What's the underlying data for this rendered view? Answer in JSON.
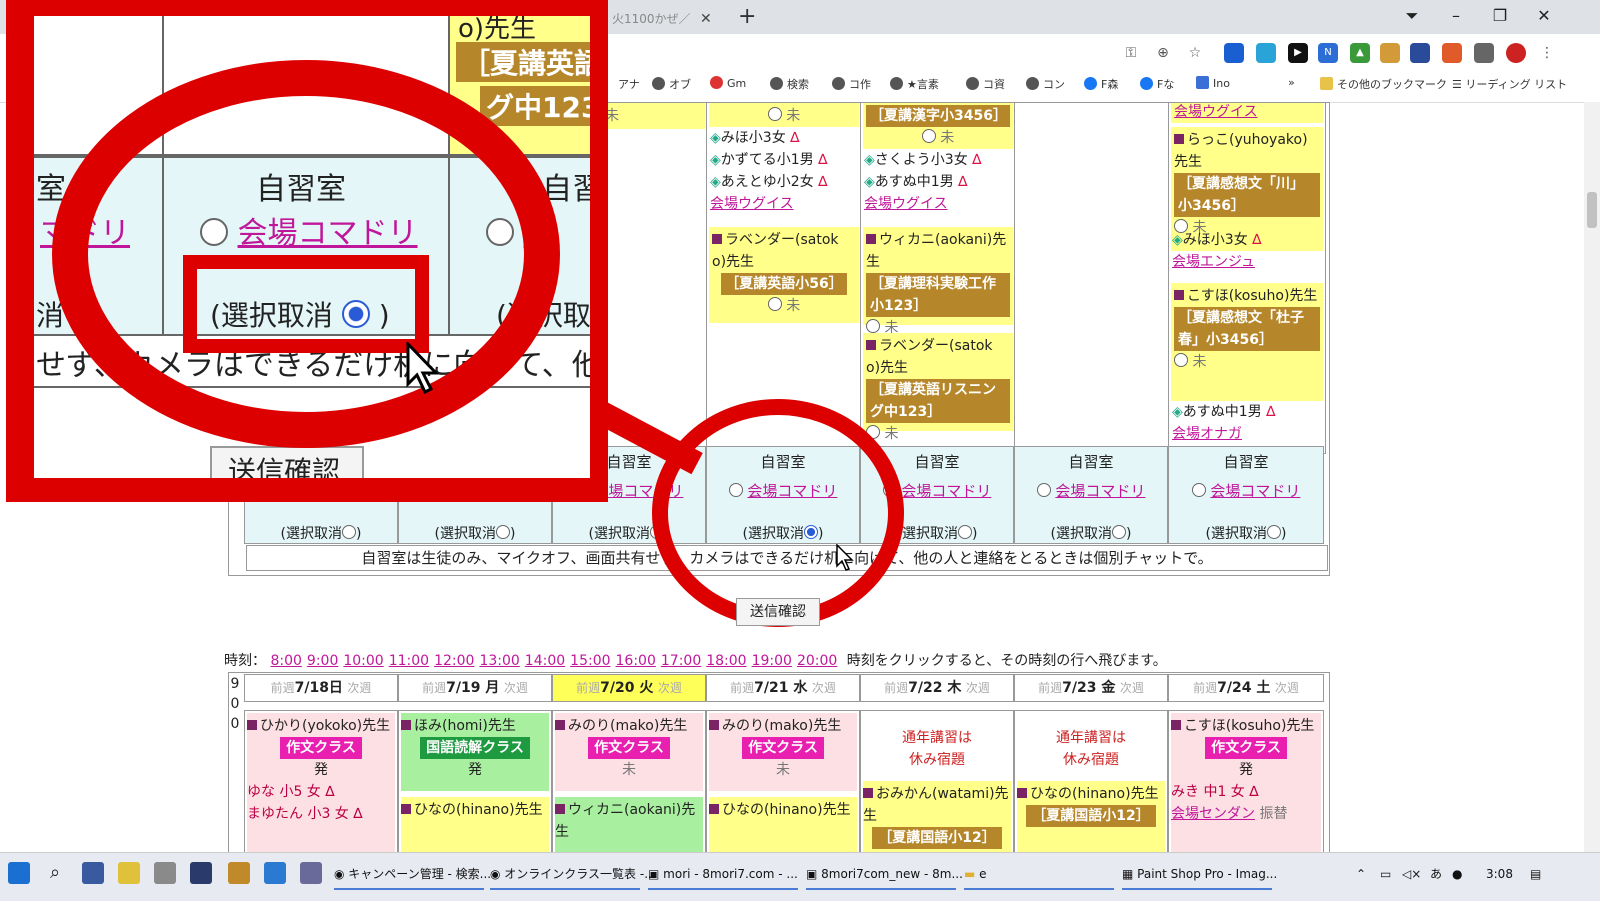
{
  "browser": {
    "tab_title": "火1100かぜ／",
    "bookmarks": [
      "アナ",
      "オブ",
      "Gm",
      "検索",
      "コ作",
      "★言素",
      "コ資",
      "コン",
      "F森",
      "Fな",
      "Ino",
      "その他のブックマーク",
      "リーディング リスト"
    ],
    "more_label": "»"
  },
  "columns": {
    "tue": {
      "badge_top": "6]",
      "mi": "未"
    },
    "wed": {
      "mi_top": "未",
      "students": [
        {
          "name": "みほ小3女",
          "mark": "∆"
        },
        {
          "name": "かずてる小1男",
          "mark": "∆"
        },
        {
          "name": "あえとゆ小2女",
          "mark": "∆"
        }
      ],
      "venue": "会場ウグイス",
      "card": {
        "teacher": "ラベンダー(satok o)先生",
        "badge": "［夏講英語小56］",
        "mi": "未"
      }
    },
    "thu": {
      "badge_top": "［夏講漢字小3456］",
      "mi_top": "未",
      "students": [
        {
          "name": "さくよう小3女",
          "mark": "∆"
        },
        {
          "name": "あすぬ中1男",
          "mark": "∆"
        }
      ],
      "venue": "会場ウグイス",
      "card1": {
        "teacher": "ウィカニ(aokani)先生",
        "badge": "［夏講理科実験工作小123］",
        "mi": "未"
      },
      "card2": {
        "teacher": "ラベンダー(satok o)先生",
        "badge": "［夏講英語リスニング中123］",
        "mi": "未"
      }
    },
    "sat": {
      "venue_top": "会場ウグイス",
      "card1": {
        "teacher": "らっこ(yuhoyako)先生",
        "badge": "［夏講感想文「川」小3456］",
        "mi": "未"
      },
      "student1": {
        "name": "みほ小3女",
        "mark": "∆"
      },
      "venue1": "会場エンジュ",
      "card2": {
        "teacher": "こすほ(kosuho)先生",
        "badge": "［夏講感想文「杜子春」小3456］",
        "mi": "未"
      },
      "student2": {
        "name": "あすぬ中1男",
        "mark": "∆"
      },
      "venue2": "会場オナガ"
    }
  },
  "selfstudy": {
    "heading": "自習室",
    "venue": "会場コマドリ",
    "cancel_prefix": "(選択取消",
    "cancel_suffix": ")"
  },
  "notice": "自習室は生徒のみ、マイクオフ、画面共有せず、カメラはできるだけ机に向けて、他の人と連絡をとるときは個別チャットで。",
  "send_button": "送信確認",
  "timebar": {
    "label": "時刻：",
    "times": [
      "8:00",
      "9:00",
      "10:00",
      "11:00",
      "12:00",
      "13:00",
      "14:00",
      "15:00",
      "16:00",
      "17:00",
      "18:00",
      "19:00",
      "20:00"
    ],
    "hint": "時刻をクリックすると、その時刻の行へ飛びます。"
  },
  "week": {
    "hour": [
      "9",
      "0",
      "0"
    ],
    "prev": "前週",
    "next": "次週",
    "days": [
      "7/18日",
      "7/19 月",
      "7/20 火",
      "7/21 水",
      "7/22 木",
      "7/23 金",
      "7/24 土"
    ],
    "sun": {
      "teacher": "ひかり(yokoko)先生",
      "tag": "作文クラス",
      "status": "発",
      "s1": "ゆな 小5 女 ∆",
      "s2": "まゆたん 小3 女 ∆"
    },
    "mon": {
      "teacher": "ほみ(homi)先生",
      "tag": "国語読解クラス",
      "status": "発",
      "teacher2": "ひなの(hinano)先生"
    },
    "tue": {
      "teacher": "みのり(mako)先生",
      "tag": "作文クラス",
      "status": "未",
      "teacher2": "ウィカニ(aokani)先生"
    },
    "wed": {
      "teacher": "みのり(mako)先生",
      "tag": "作文クラス",
      "status": "未",
      "teacher2": "ひなの(hinano)先生"
    },
    "thu": {
      "line1": "通年講習は",
      "line2": "休み宿題",
      "teacher": "おみかん(watami)先生",
      "badge": "［夏講国語小12］"
    },
    "fri": {
      "line1": "通年講習は",
      "line2": "休み宿題",
      "teacher": "ひなの(hinano)先生",
      "badge": "［夏講国語小12］"
    },
    "sat": {
      "teacher": "こすほ(kosuho)先生",
      "tag": "作文クラス",
      "status": "発",
      "student": "みき 中1 女 ∆",
      "venue": "会場センダン",
      "transfer": "振替"
    }
  },
  "zoom": {
    "top_text": "o)先生",
    "badge1": "［夏講英語",
    "badge2": "グ中123",
    "heading": "自習室",
    "left_frag": "室",
    "right_frag": "自習",
    "venue_frag_left": "マドリ",
    "venue_frag_right": "場",
    "cancel_left": "消",
    "cancel_center": "(選択取消",
    "cancel_close": ")",
    "cancel_right": "(選択取",
    "notice": "せず、カメラはできるだけ机に向けて、他",
    "send_frag": "送信確認"
  },
  "taskbar": {
    "items": [
      "キャンペーン管理 - 検索...",
      "オンラインクラス一覧表 -...",
      "mori - 8mori7.com - ...",
      "8mori7com_new - 8m...",
      "e",
      "Paint Shop Pro - Imag..."
    ],
    "ime": "あ",
    "time": "3:08"
  },
  "colors": {
    "highlight_red": "#dd0000",
    "selfstudy_bg": "#e4f6f8",
    "card_yellow": "#ffff8a",
    "link_magenta": "#c0179a"
  }
}
